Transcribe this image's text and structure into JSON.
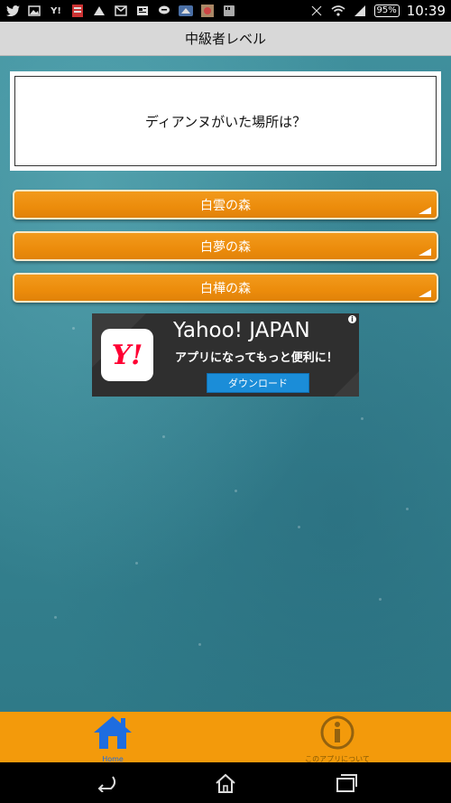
{
  "status_bar": {
    "left_icons": [
      "twitter-icon",
      "image-icon",
      "yahoo-icon",
      "app-icon",
      "notify-icon",
      "mail-icon",
      "news-icon",
      "chat-icon",
      "app2-icon",
      "game-icon",
      "sd-icon"
    ],
    "battery": "95%",
    "time": "10:39"
  },
  "header": {
    "title": "中級者レベル"
  },
  "question": {
    "text": "ディアンヌがいた場所は？"
  },
  "answers": [
    {
      "label": "白雲の森"
    },
    {
      "label": "白夢の森"
    },
    {
      "label": "白樺の森"
    }
  ],
  "ad": {
    "logo_text": "Y!",
    "title": "Yahoo! JAPAN",
    "subtitle": "アプリになってもっと便利に！",
    "button_label": "ダウンロード"
  },
  "tabs": [
    {
      "label": "Home",
      "icon": "home-icon"
    },
    {
      "label": "このアプリについて",
      "icon": "info-icon"
    }
  ],
  "nav": [
    "back-icon",
    "home-nav-icon",
    "recents-icon"
  ],
  "colors": {
    "accent": "#f39a0b",
    "tab_active": "#1e6de0",
    "background": "#3a8694"
  }
}
